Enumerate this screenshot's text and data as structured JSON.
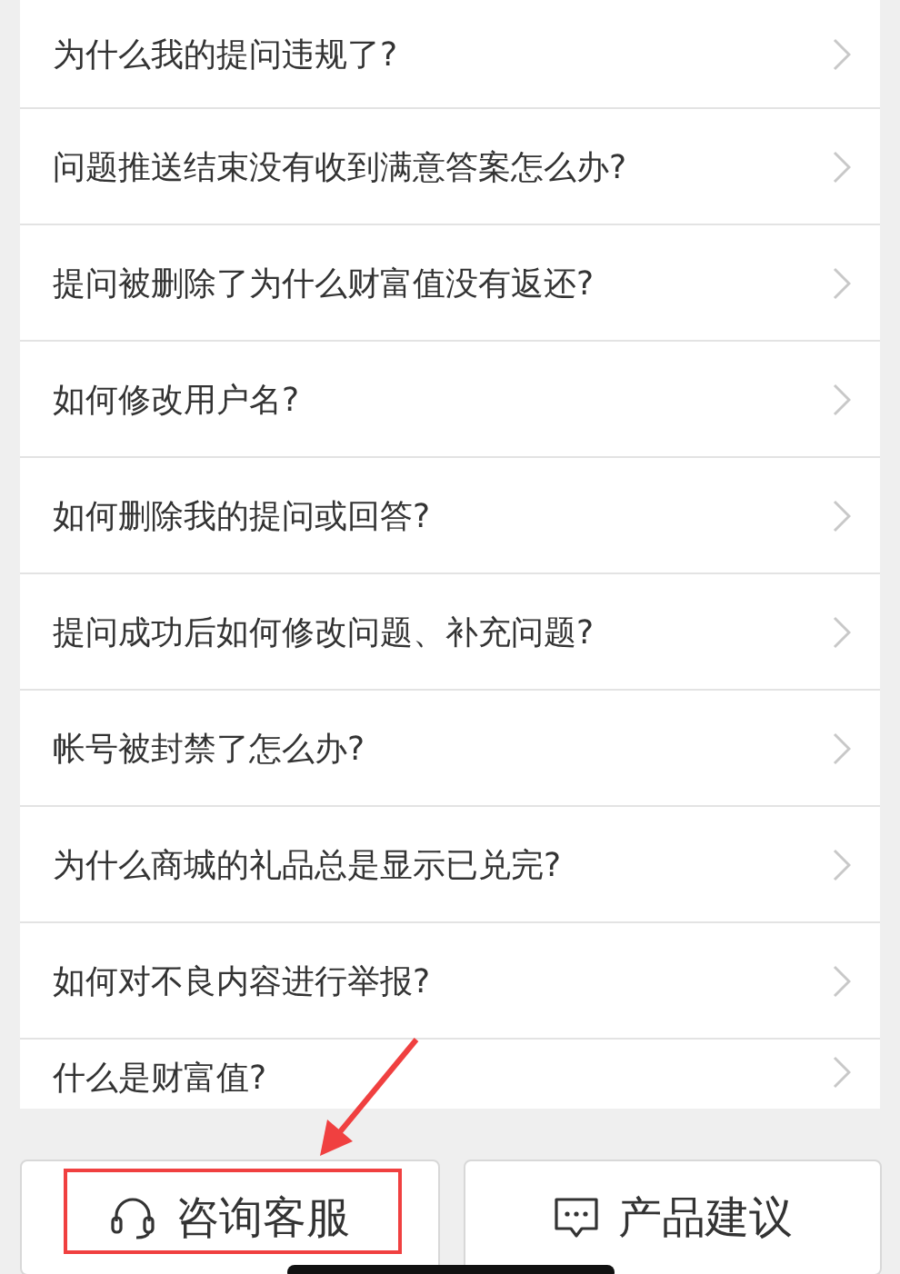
{
  "questions": [
    {
      "text": "为什么我的提问违规了?"
    },
    {
      "text": "问题推送结束没有收到满意答案怎么办?"
    },
    {
      "text": "提问被删除了为什么财富值没有返还?"
    },
    {
      "text": "如何修改用户名?"
    },
    {
      "text": "如何删除我的提问或回答?"
    },
    {
      "text": "提问成功后如何修改问题、补充问题?"
    },
    {
      "text": "帐号被封禁了怎么办?"
    },
    {
      "text": "为什么商城的礼品总是显示已兑完?"
    },
    {
      "text": "如何对不良内容进行举报?"
    },
    {
      "text": "什么是财富值?"
    }
  ],
  "buttons": [
    {
      "label": "咨询客服",
      "kind": "headset"
    },
    {
      "label": "产品建议",
      "kind": "chat"
    }
  ]
}
